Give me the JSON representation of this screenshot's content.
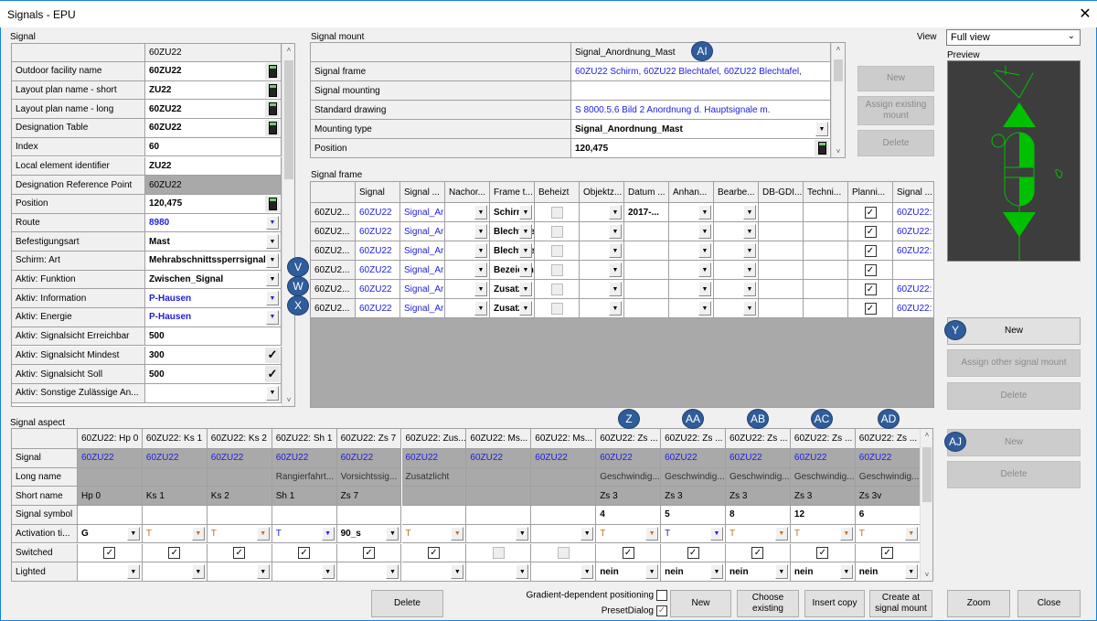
{
  "window": {
    "title": "Signals - EPU",
    "close_icon": "close-icon"
  },
  "signal": {
    "label": "Signal",
    "header": "60ZU22",
    "rows": [
      {
        "label": "Outdoor facility name",
        "value": "60ZU22",
        "style": "bold",
        "ctl": "calc"
      },
      {
        "label": "Layout plan name - short",
        "value": "ZU22",
        "style": "bold",
        "ctl": "calc"
      },
      {
        "label": "Layout plan name - long",
        "value": "60ZU22",
        "style": "bold",
        "ctl": "calc"
      },
      {
        "label": "Designation Table",
        "value": "60ZU22",
        "style": "bold",
        "ctl": "calc"
      },
      {
        "label": "Index",
        "value": "60",
        "style": "bold",
        "ctl": ""
      },
      {
        "label": "Local element identifier",
        "value": "ZU22",
        "style": "bold",
        "ctl": ""
      },
      {
        "label": "Designation Reference Point",
        "value": "60ZU22",
        "style": "gray",
        "ctl": ""
      },
      {
        "label": "Position",
        "value": "120,475",
        "style": "bold",
        "ctl": "calc"
      },
      {
        "label": "Route",
        "value": "8980",
        "style": "bold blue",
        "ctl": "dd"
      },
      {
        "label": "Befestigungsart",
        "value": "Mast",
        "style": "bold",
        "ctl": "dd"
      },
      {
        "label": "Schirm: Art",
        "value": "Mehrabschnittssperrsignal",
        "style": "bold",
        "ctl": "dd"
      },
      {
        "label": "Aktiv: Funktion",
        "value": "Zwischen_Signal",
        "style": "bold",
        "ctl": "dd"
      },
      {
        "label": "Aktiv: Information",
        "value": "P-Hausen",
        "style": "bold blue",
        "ctl": "dd"
      },
      {
        "label": "Aktiv: Energie",
        "value": "P-Hausen",
        "style": "bold blue",
        "ctl": "dd"
      },
      {
        "label": "Aktiv: Signalsicht Erreichbar",
        "value": "500",
        "style": "bold",
        "ctl": ""
      },
      {
        "label": "Aktiv: Signalsicht Mindest",
        "value": "300",
        "style": "bold",
        "ctl": "check"
      },
      {
        "label": "Aktiv: Signalsicht Soll",
        "value": "500",
        "style": "bold",
        "ctl": "check"
      },
      {
        "label": "Aktiv: Sonstige Zulässige An...",
        "value": "",
        "style": "",
        "ctl": "dd"
      }
    ]
  },
  "signal_mount": {
    "label": "Signal mount",
    "header": "Signal_Anordnung_Mast",
    "rows": [
      {
        "label": "Signal frame",
        "value": "60ZU22 Schirm, 60ZU22 Blechtafel, 60ZU22 Blechtafel,",
        "style": "blue",
        "ctl": ""
      },
      {
        "label": "Signal mounting",
        "value": "",
        "style": "",
        "ctl": ""
      },
      {
        "label": "Standard drawing",
        "value": "S 8000.5.6 Bild 2 Anordnung d. Hauptsignale m.",
        "style": "blue",
        "ctl": ""
      },
      {
        "label": "Mounting type",
        "value": "Signal_Anordnung_Mast",
        "style": "bold",
        "ctl": "dd"
      },
      {
        "label": "Position",
        "value": "120,475",
        "style": "bold",
        "ctl": "calc"
      }
    ],
    "buttons": {
      "new": "New",
      "assign": "Assign existing mount",
      "delete": "Delete"
    }
  },
  "view": {
    "label": "View",
    "selected": "Full view",
    "preview_label": "Preview",
    "symbol_color": "#00c000"
  },
  "signal_frame": {
    "label": "Signal frame",
    "columns": [
      "",
      "Signal",
      "Signal ...",
      "Nachor...",
      "Frame t...",
      "Beheizt",
      "Objektz...",
      "Datum ...",
      "Anhan...",
      "Bearbe...",
      "DB-GDI...",
      "Techni...",
      "Planni...",
      "Signal ..."
    ],
    "rows": [
      {
        "id": "60ZU2...",
        "signal": "60ZU22",
        "mount": "Signal_Ar",
        "frame": "Schirm",
        "datum": "2017-...",
        "planning": true,
        "ref": "60ZU22:"
      },
      {
        "id": "60ZU2...",
        "signal": "60ZU22",
        "mount": "Signal_Ar",
        "frame": "Blechtafel",
        "datum": "",
        "planning": true,
        "ref": "60ZU22:"
      },
      {
        "id": "60ZU2...",
        "signal": "60ZU22",
        "mount": "Signal_Ar",
        "frame": "Blechtafel",
        "datum": "",
        "planning": true,
        "ref": "60ZU22:"
      },
      {
        "id": "60ZU2...",
        "signal": "60ZU22",
        "mount": "Signal_Ar",
        "frame": "Bezeichnung",
        "datum": "",
        "planning": true,
        "ref": ""
      },
      {
        "id": "60ZU2...",
        "signal": "60ZU22",
        "mount": "Signal_Ar",
        "frame": "Zusatz",
        "datum": "",
        "planning": true,
        "ref": "60ZU22:"
      },
      {
        "id": "60ZU2...",
        "signal": "60ZU22",
        "mount": "Signal_Ar",
        "frame": "Zusatz",
        "datum": "",
        "planning": true,
        "ref": "60ZU22:"
      }
    ],
    "buttons": {
      "new": "New",
      "assign": "Assign other signal mount",
      "delete": "Delete"
    }
  },
  "signal_aspect": {
    "label": "Signal aspect",
    "row_labels": [
      "Signal",
      "Long name",
      "Short name",
      "Signal symbol",
      "Activation ti...",
      "Switched",
      "Lighted"
    ],
    "columns": [
      {
        "header": "60ZU22: Hp 0",
        "signal": "60ZU22",
        "long": "",
        "short": "Hp 0",
        "symbol": "",
        "activation": "G",
        "act_style": "bold",
        "switched": true,
        "sw_enabled": true,
        "lighted": ""
      },
      {
        "header": "60ZU22: Ks 1",
        "signal": "60ZU22",
        "long": "",
        "short": "Ks 1",
        "symbol": "",
        "activation": "T",
        "act_style": "orange",
        "switched": true,
        "sw_enabled": true,
        "lighted": ""
      },
      {
        "header": "60ZU22: Ks 2",
        "signal": "60ZU22",
        "long": "",
        "short": "Ks 2",
        "symbol": "",
        "activation": "T",
        "act_style": "orange",
        "switched": true,
        "sw_enabled": true,
        "lighted": ""
      },
      {
        "header": "60ZU22: Sh 1",
        "signal": "60ZU22",
        "long": "Rangierfahrt...",
        "short": "Sh 1",
        "symbol": "",
        "activation": "T",
        "act_style": "blue",
        "switched": true,
        "sw_enabled": true,
        "lighted": ""
      },
      {
        "header": "60ZU22: Zs 7",
        "signal": "60ZU22",
        "long": "Vorsichtssig...",
        "short": "Zs 7",
        "symbol": "",
        "activation": "90_s",
        "act_style": "bold",
        "switched": true,
        "sw_enabled": true,
        "lighted": ""
      },
      {
        "header": "60ZU22: Zus...",
        "signal": "60ZU22",
        "long": "Zusatzlicht",
        "short": "",
        "symbol": "",
        "activation": "T",
        "act_style": "orange",
        "switched": true,
        "sw_enabled": true,
        "lighted": ""
      },
      {
        "header": "60ZU22: Ms...",
        "signal": "60ZU22",
        "long": "",
        "short": "",
        "symbol": "",
        "activation": "",
        "act_style": "",
        "switched": false,
        "sw_enabled": false,
        "lighted": ""
      },
      {
        "header": "60ZU22: Ms...",
        "signal": "60ZU22",
        "long": "",
        "short": "",
        "symbol": "",
        "activation": "",
        "act_style": "",
        "switched": false,
        "sw_enabled": false,
        "lighted": ""
      },
      {
        "header": "60ZU22: Zs ...",
        "signal": "60ZU22",
        "long": "Geschwindig...",
        "short": "Zs 3",
        "symbol": "4",
        "activation": "T",
        "act_style": "orange",
        "switched": true,
        "sw_enabled": true,
        "lighted": "nein"
      },
      {
        "header": "60ZU22: Zs ...",
        "signal": "60ZU22",
        "long": "Geschwindig...",
        "short": "Zs 3",
        "symbol": "5",
        "activation": "T",
        "act_style": "blue",
        "switched": true,
        "sw_enabled": true,
        "lighted": "nein"
      },
      {
        "header": "60ZU22: Zs ...",
        "signal": "60ZU22",
        "long": "Geschwindig...",
        "short": "Zs 3",
        "symbol": "8",
        "activation": "T",
        "act_style": "orange",
        "switched": true,
        "sw_enabled": true,
        "lighted": "nein"
      },
      {
        "header": "60ZU22: Zs ...",
        "signal": "60ZU22",
        "long": "Geschwindig...",
        "short": "Zs 3",
        "symbol": "12",
        "activation": "T",
        "act_style": "orange",
        "switched": true,
        "sw_enabled": true,
        "lighted": "nein"
      },
      {
        "header": "60ZU22: Zs ...",
        "signal": "60ZU22",
        "long": "Geschwindig...",
        "short": "Zs 3v",
        "symbol": "6",
        "activation": "T",
        "act_style": "orange",
        "switched": true,
        "sw_enabled": true,
        "lighted": "nein"
      }
    ],
    "buttons": {
      "new": "New",
      "delete": "Delete"
    }
  },
  "footer": {
    "delete": "Delete",
    "gradient_label": "Gradient-dependent positioning",
    "gradient_checked": false,
    "preset_label": "PresetDialog",
    "preset_checked": true,
    "new": "New",
    "choose": "Choose existing",
    "insert": "Insert copy",
    "create": "Create at signal mount",
    "zoom": "Zoom",
    "close": "Close"
  },
  "annotations": [
    "AI",
    "V",
    "W",
    "X",
    "Y",
    "Z",
    "AA",
    "AB",
    "AC",
    "AD",
    "AJ"
  ]
}
